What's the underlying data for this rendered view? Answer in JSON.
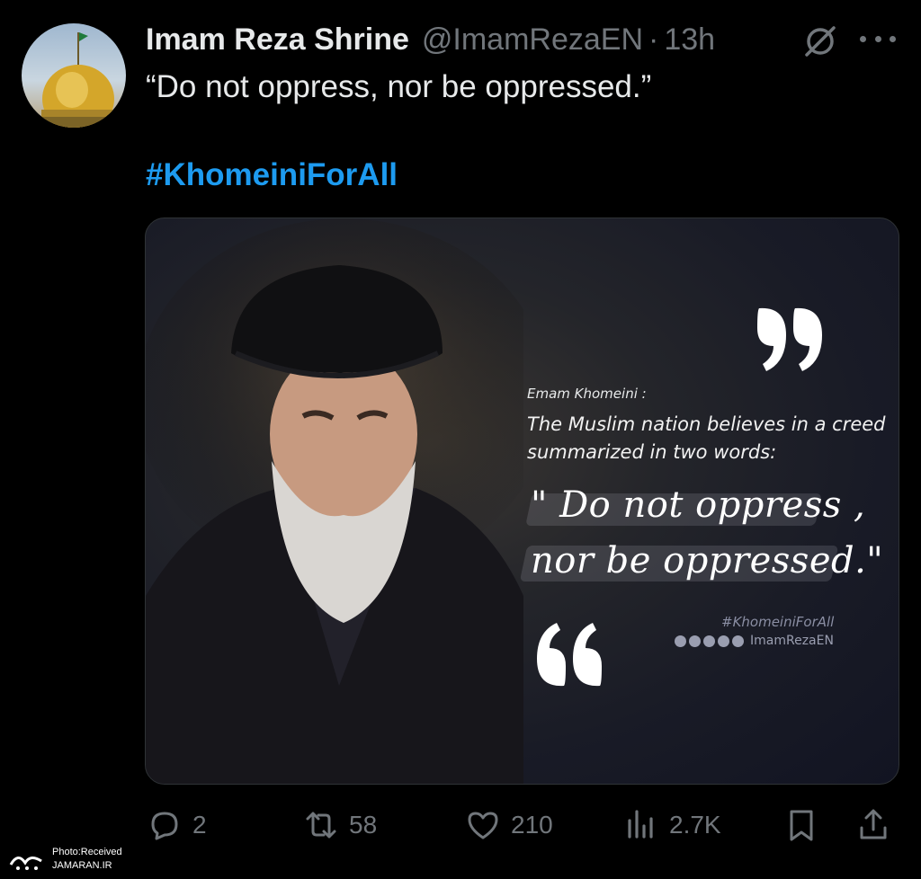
{
  "tweet": {
    "display_name": "Imam Reza Shrine",
    "handle": "@ImamRezaEN",
    "separator": "·",
    "time": "13h",
    "text": "“Do not oppress, nor be oppressed.”",
    "hashtag": "#KhomeiniForAll"
  },
  "media": {
    "attribution": "Emam Khomeini :",
    "lead_text": "The Muslim nation believes in a creed summarized in two words:",
    "quote_line1": "\" Do not oppress ,",
    "quote_line2": "nor be oppressed.\"",
    "hashtag": "#KhomeiniForAll",
    "social_handle": "ImamRezaEN"
  },
  "actions": {
    "replies": "2",
    "reposts": "58",
    "likes": "210",
    "views": "2.7K"
  },
  "watermark": {
    "line1": "Photo:Received",
    "line2": "JAMARAN.IR"
  },
  "icons": {
    "reply": "reply-icon",
    "repost": "repost-icon",
    "like": "heart-icon",
    "views": "views-icon",
    "bookmark": "bookmark-icon",
    "share": "share-icon",
    "grok": "grok-icon",
    "more": "more-icon"
  },
  "colors": {
    "background": "#000000",
    "text": "#e7e9ea",
    "muted": "#71767b",
    "link": "#1d9bf0"
  }
}
